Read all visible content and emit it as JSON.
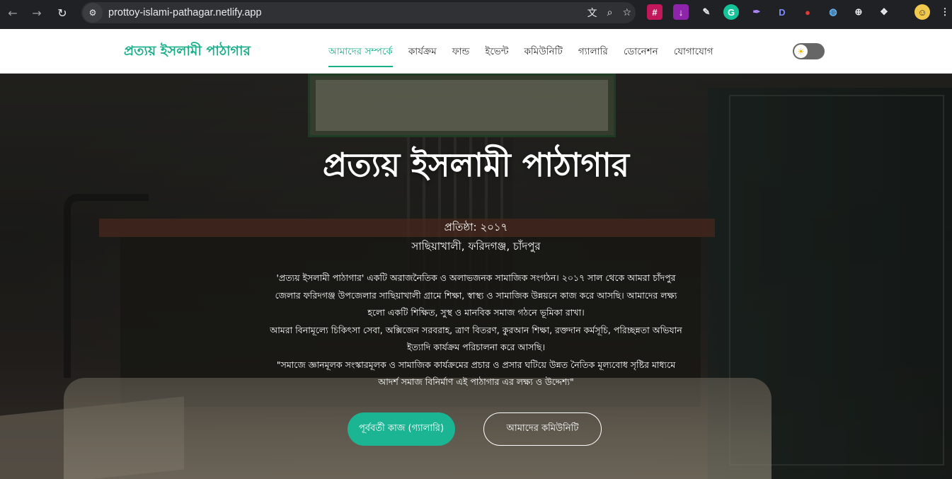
{
  "browser": {
    "url": "prottoy-islami-pathagar.netlify.app",
    "back_icon": "arrow-left-icon",
    "forward_icon": "arrow-right-icon",
    "reload_icon": "reload-icon"
  },
  "site": {
    "brand": "প্রত্যয় ইসলামী পাঠাগার",
    "menu": [
      {
        "label": "আমাদের সম্পর্কে",
        "active": true
      },
      {
        "label": "কার্যক্রম"
      },
      {
        "label": "ফান্ড"
      },
      {
        "label": "ইভেন্ট"
      },
      {
        "label": "কমিউনিটি"
      },
      {
        "label": "গ্যালারি"
      },
      {
        "label": "ডোনেশন"
      },
      {
        "label": "যোগাযোগ"
      }
    ],
    "theme_toggle_icon": "sun-icon"
  },
  "hero": {
    "title": "প্রত্যয় ইসলামী পাঠাগার",
    "established": "প্রতিষ্ঠা: ২০১৭",
    "location": "সাছিয়াখালী, ফরিদগঞ্জ, চাঁদপুর",
    "desc_lines": [
      "'প্রত্যয় ইসলামী পাঠাগার' একটি অরাজনৈতিক ও অলাভজনক সামাজিক সংগঠন। ২০১৭ সাল থেকে আমরা চাঁদপুর",
      "জেলার ফরিদগঞ্জ উপজেলার সাছিয়াখালী গ্রামে শিক্ষা, স্বাস্থ্য ও সামাজিক উন্নয়নে কাজ করে আসছি। আমাদের লক্ষ্য",
      "হলো একটি শিক্ষিত, সুস্থ ও মানবিক সমাজ গঠনে ভূমিকা রাখা।",
      "আমরা বিনামূল্যে চিকিৎসা সেবা, অক্সিজেন সরবরাহ, ত্রাণ বিতরণ, কুরআন শিক্ষা, রক্তদান কর্মসূচি, পরিচ্ছন্নতা অভিযান",
      "ইত্যাদি কার্যক্রম পরিচালনা করে আসছি।",
      "\"সমাজে জ্ঞানমূলক সংস্কারমূলক ও সামাজিক কার্যক্রমের প্রচার ও প্রসার ঘটিয়ে উন্নত নৈতিক মূল্যবোধ সৃষ্টির মাধ্যমে",
      "আদর্শ সমাজ বিনির্মাণ এই পাঠাগার এর লক্ষ্য ও উদ্দেশ্য\""
    ],
    "primary_button": "পূর্ববর্তী কাজ (গ্যালারি)",
    "secondary_button": "আমাদের কমিউনিটি"
  },
  "colors": {
    "accent": "#1aae8a",
    "button": "#1bb594"
  }
}
